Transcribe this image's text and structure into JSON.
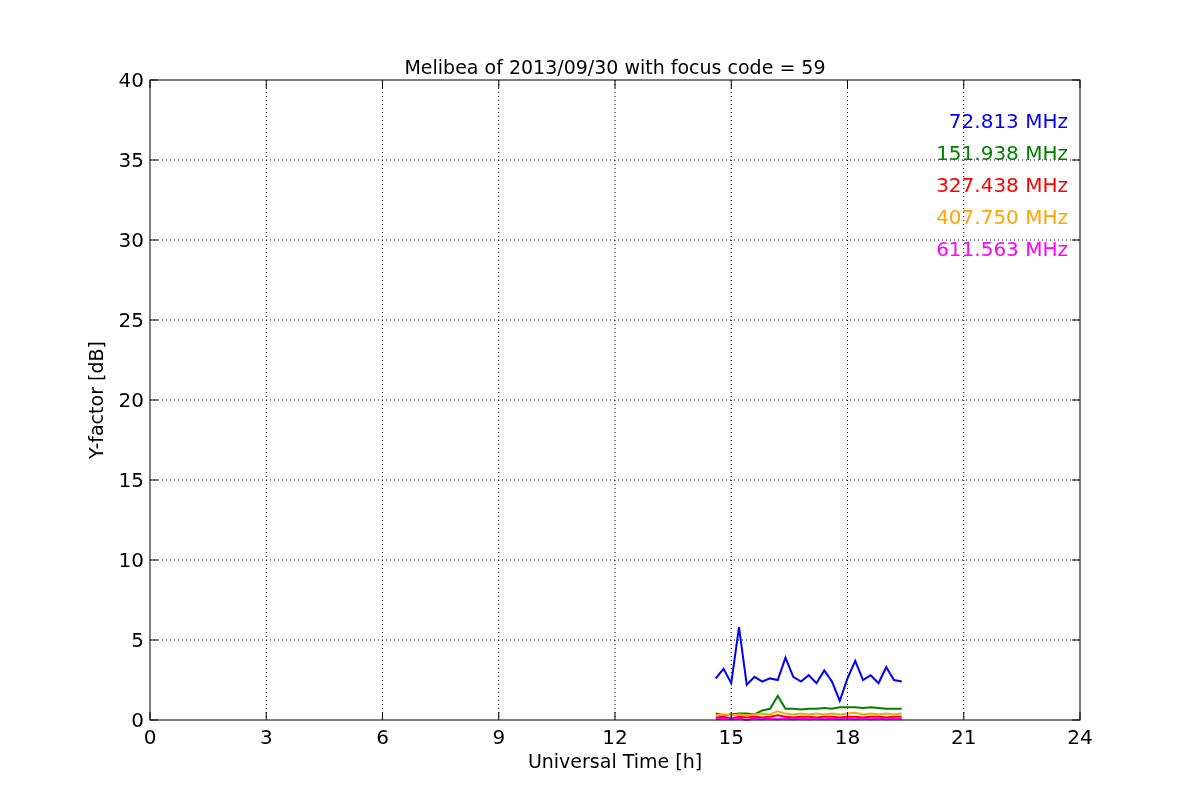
{
  "chart_data": {
    "type": "line",
    "title": "Melibea of 2013/09/30 with focus code = 59",
    "xlabel": "Universal Time [h]",
    "ylabel": "Y-factor [dB]",
    "x": [
      14.6,
      14.8,
      15.0,
      15.2,
      15.4,
      15.6,
      15.8,
      16.0,
      16.2,
      16.4,
      16.6,
      16.8,
      17.0,
      17.2,
      17.4,
      17.6,
      17.8,
      18.0,
      18.2,
      18.4,
      18.6,
      18.8,
      19.0,
      19.2,
      19.4
    ],
    "series": [
      {
        "name": "72.813 MHz",
        "color": "#0000ff",
        "values": [
          2.6,
          3.2,
          2.3,
          5.8,
          2.2,
          2.7,
          2.4,
          2.6,
          2.5,
          3.9,
          2.7,
          2.4,
          2.8,
          2.3,
          3.1,
          2.4,
          1.2,
          2.6,
          3.7,
          2.5,
          2.8,
          2.3,
          3.3,
          2.5,
          2.4
        ]
      },
      {
        "name": "151.938 MHz",
        "color": "#008000",
        "values": [
          0.4,
          0.3,
          0.35,
          0.4,
          0.4,
          0.35,
          0.6,
          0.7,
          1.5,
          0.7,
          0.7,
          0.65,
          0.7,
          0.7,
          0.75,
          0.7,
          0.8,
          0.8,
          0.8,
          0.75,
          0.8,
          0.75,
          0.7,
          0.7,
          0.7
        ]
      },
      {
        "name": "327.438 MHz",
        "color": "#ff0000",
        "values": [
          0.15,
          0.2,
          0.1,
          0.2,
          0.15,
          0.2,
          0.15,
          0.2,
          0.3,
          0.2,
          0.15,
          0.2,
          0.2,
          0.15,
          0.2,
          0.2,
          0.15,
          0.2,
          0.2,
          0.15,
          0.2,
          0.2,
          0.15,
          0.2,
          0.2
        ]
      },
      {
        "name": "407.750 MHz",
        "color": "#ffa500",
        "values": [
          0.3,
          0.35,
          0.3,
          0.35,
          0.3,
          0.35,
          0.4,
          0.35,
          0.55,
          0.4,
          0.35,
          0.4,
          0.35,
          0.4,
          0.35,
          0.4,
          0.35,
          0.4,
          0.45,
          0.35,
          0.4,
          0.35,
          0.4,
          0.35,
          0.4
        ]
      },
      {
        "name": "611.563 MHz",
        "color": "#ff00ff",
        "values": [
          0.05,
          0.1,
          0.05,
          0.1,
          0.0,
          0.1,
          0.05,
          0.1,
          0.05,
          0.1,
          0.05,
          0.1,
          0.05,
          0.1,
          0.05,
          0.1,
          0.05,
          0.1,
          0.05,
          0.1,
          0.05,
          0.1,
          0.05,
          0.1,
          0.05
        ]
      }
    ],
    "grid": true,
    "xlim": [
      0,
      24
    ],
    "ylim": [
      0,
      40
    ],
    "xticks": [
      0,
      3,
      6,
      9,
      12,
      15,
      18,
      21,
      24
    ],
    "yticks": [
      0,
      5,
      10,
      15,
      20,
      25,
      30,
      35,
      40
    ]
  }
}
